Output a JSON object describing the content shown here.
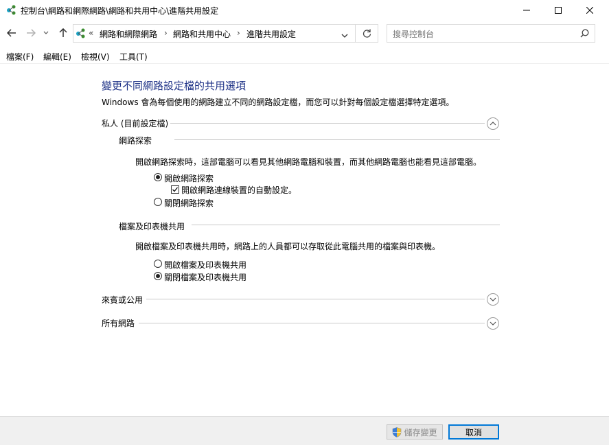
{
  "window": {
    "title": "控制台\\網路和網際網路\\網路和共用中心\\進階共用設定"
  },
  "address": {
    "overflow": "«",
    "crumbs": [
      "網路和網際網路",
      "網路和共用中心",
      "進階共用設定"
    ],
    "search_placeholder": "搜尋控制台"
  },
  "menu": [
    "檔案(F)",
    "編輯(E)",
    "檢視(V)",
    "工具(T)"
  ],
  "content": {
    "heading": "變更不同網路設定檔的共用選項",
    "intro": "Windows 會為每個使用的網路建立不同的網路設定檔，而您可以針對每個設定檔選擇特定選項。",
    "private": {
      "label": "私人 (目前設定檔)",
      "discovery": {
        "label": "網路探索",
        "desc": "開啟網路探索時，這部電腦可以看見其他網路電腦和裝置，而其他網路電腦也能看見這部電腦。",
        "on_label": "開啟網路探索",
        "on_selected": true,
        "auto_label": "開啟網路連線裝置的自動設定。",
        "auto_checked": true,
        "off_label": "關閉網路探索",
        "off_selected": false
      },
      "sharing": {
        "label": "檔案及印表機共用",
        "desc": "開啟檔案及印表機共用時，網路上的人員都可以存取從此電腦共用的檔案與印表機。",
        "on_label": "開啟檔案及印表機共用",
        "on_selected": false,
        "off_label": "關閉檔案及印表機共用",
        "off_selected": true
      }
    },
    "guest": {
      "label": "來賓或公用"
    },
    "all": {
      "label": "所有網路"
    }
  },
  "footer": {
    "save_label": "儲存變更",
    "cancel_label": "取消"
  },
  "colors": {
    "heading": "#1e3287",
    "accent": "#0078d7",
    "footer_bg": "#f0f0f0"
  }
}
